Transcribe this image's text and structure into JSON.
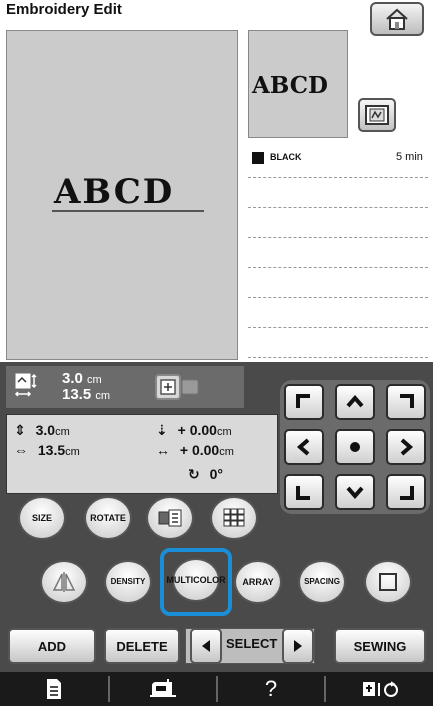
{
  "header": {
    "title": "Embroidery Edit",
    "home_icon": "home-icon"
  },
  "edit_area": {
    "text": "ABCD"
  },
  "preview": {
    "text": "ABCD",
    "frame_icon": "embroidery-frame-icon"
  },
  "color_list": {
    "items": [
      {
        "swatch_color": "#111111",
        "name": "BLACK",
        "time": "5 min"
      }
    ]
  },
  "size_bar": {
    "height_value": "3.0",
    "width_value": "13.5",
    "unit": "cm"
  },
  "info": {
    "height_value": "3.0",
    "width_value": "13.5",
    "unit": "cm",
    "vertical_offset": "+ 0.00",
    "horizontal_offset": "+ 0.00",
    "rotation": "0°"
  },
  "buttons": {
    "size": "SIZE",
    "rotate": "ROTATE",
    "density": "DENSITY",
    "multi_color_line1": "MULTI",
    "multi_color_line2": "COLOR",
    "array": "ARRAY",
    "spacing": "SPACING",
    "add": "ADD",
    "delete": "DELETE",
    "select": "SELECT",
    "sewing": "SEWING"
  },
  "bottom_bar": {
    "help": "?"
  },
  "colors": {
    "highlight": "#1a8fd8",
    "panel": "#4a4a4a",
    "canvas": "#cbcbcb"
  }
}
